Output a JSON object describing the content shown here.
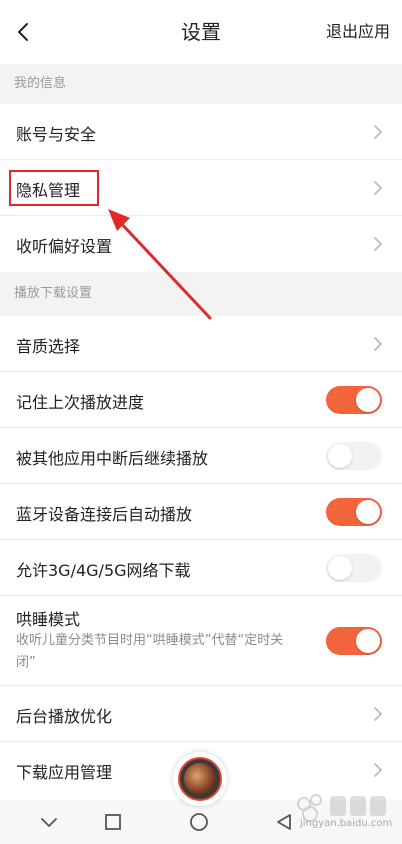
{
  "header": {
    "title": "设置",
    "exit_label": "退出应用"
  },
  "sections": {
    "my_info": "我的信息",
    "playback_download": "播放下载设置"
  },
  "rows": {
    "account_security": "账号与安全",
    "privacy": "隐私管理",
    "listening_prefs": "收听偏好设置",
    "audio_quality": "音质选择",
    "remember_progress": "记住上次播放进度",
    "resume_after_interrupt": "被其他应用中断后继续播放",
    "bluetooth_autoplay": "蓝牙设备连接后自动播放",
    "allow_mobile_download": "允许3G/4G/5G网络下载",
    "sleep_mode": "哄睡模式",
    "sleep_mode_desc": "收听儿童分类节目时用“哄睡模式”代替“定时关闭”",
    "background_opt": "后台播放优化",
    "download_app_manage": "下载应用管理"
  },
  "toggles": {
    "remember_progress": true,
    "resume_after_interrupt": false,
    "bluetooth_autoplay": true,
    "allow_mobile_download": false,
    "sleep_mode": true
  },
  "colors": {
    "accent": "#f2643c",
    "annotation": "#e02a2a"
  },
  "icons": {
    "back": "chevron-left",
    "row_arrow": "chevron-right",
    "nav_back": "triangle-left",
    "nav_home": "circle",
    "nav_recent": "square",
    "nav_collapse": "chevron-down"
  },
  "watermark": {
    "text": "jingyan.baidu.com"
  }
}
